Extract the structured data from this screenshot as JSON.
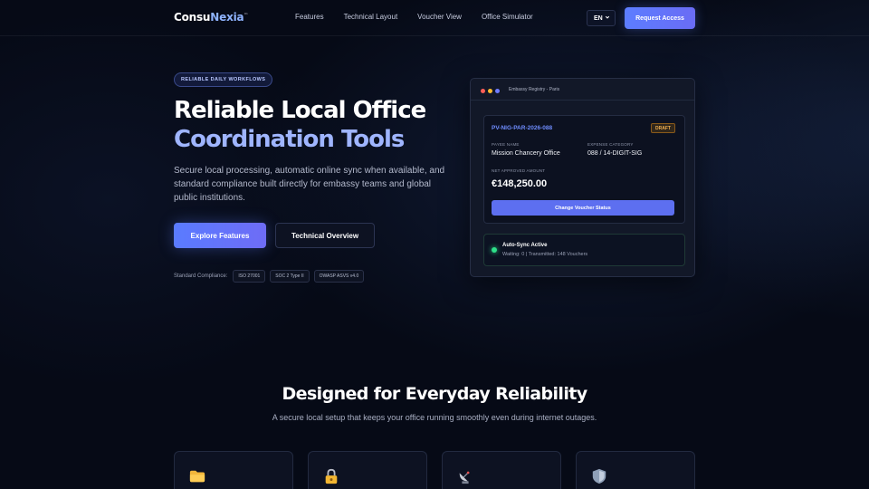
{
  "nav": {
    "logo_part1": "Consu",
    "logo_part2": "Nexia",
    "logo_tm": "™",
    "links": [
      "Features",
      "Technical Layout",
      "Voucher View",
      "Office Simulator"
    ],
    "language": "EN",
    "request_access": "Request Access"
  },
  "hero": {
    "badge": "RELIABLE DAILY WORKFLOWS",
    "title_line1": "Reliable Local Office",
    "title_line2": "Coordination Tools",
    "description": "Secure local processing, automatic online sync when available, and standard compliance built directly for embassy teams and global public institutions.",
    "primary_button": "Explore Features",
    "secondary_button": "Technical Overview",
    "compliance_label": "Standard Compliance:",
    "compliance_tags": [
      "ISO 27001",
      "SOC 2 Type II",
      "OWASP ASVS v4.0"
    ]
  },
  "preview_card": {
    "window_title": "Embassy Registry - Paris",
    "voucher_id": "PV-NIG-PAR-2026-088",
    "status": "DRAFT",
    "payee_label": "PAYEE NAME",
    "payee_value": "Mission Chancery Office",
    "expense_label": "EXPENSE CATEGORY",
    "expense_value": "088 / 14-DIGIT-SIG",
    "amount_label": "NET APPROVED AMOUNT",
    "amount_value": "€148,250.00",
    "change_button": "Change Voucher Status",
    "sync_title": "Auto-Sync Active",
    "sync_status": "Waiting: 0 | Transmitted: 148 Vouchers"
  },
  "section": {
    "title": "Designed for Everyday Reliability",
    "subtitle": "A secure local setup that keeps your office running smoothly even during internet outages.",
    "feature_icons": [
      "folder-icon",
      "lock-icon",
      "satellite-dish-icon",
      "shield-icon"
    ]
  },
  "colors": {
    "background": "#060a16",
    "accent": "#5c7dff",
    "accent_light": "#9fb5ff",
    "success": "#2ee08a",
    "warning": "#f0b050"
  }
}
